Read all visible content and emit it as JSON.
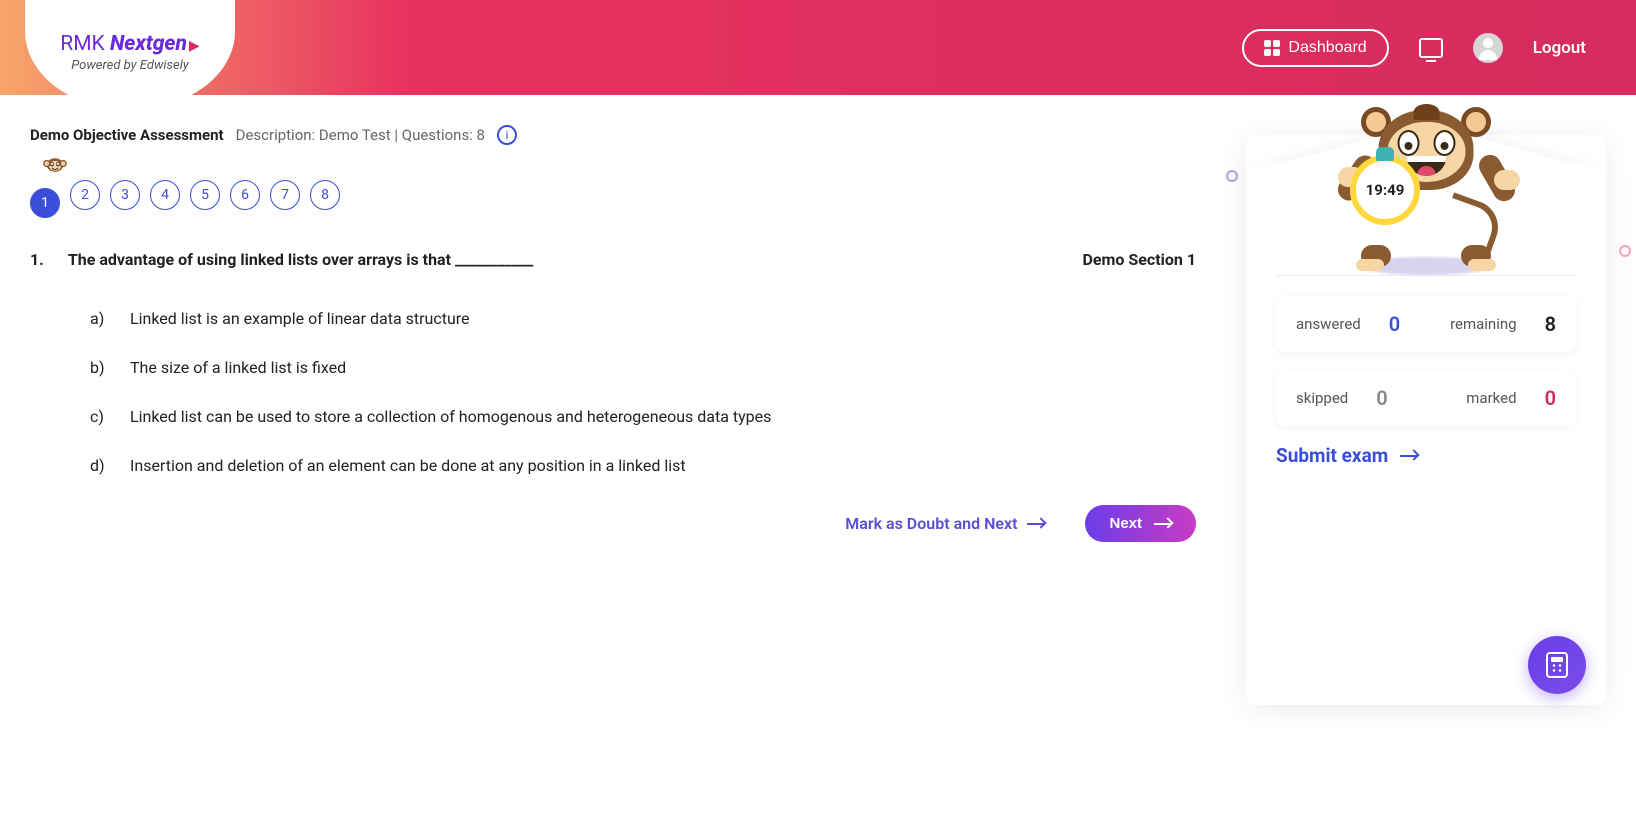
{
  "header": {
    "logo_main_prefix": "RMK ",
    "logo_main_bold": "Nextgen",
    "logo_sub": "Powered by Edwisely",
    "dashboard_label": "Dashboard",
    "logout_label": "Logout"
  },
  "assessment": {
    "title": "Demo Objective Assessment",
    "description_prefix": "Description: ",
    "description": "Demo Test",
    "questions_prefix": " | Questions: ",
    "total_questions": "8"
  },
  "question_nav": [
    "1",
    "2",
    "3",
    "4",
    "5",
    "6",
    "7",
    "8"
  ],
  "current_question_index": 0,
  "question": {
    "number": "1.",
    "text": "The advantage of using linked lists over arrays is that ___________",
    "section": "Demo Section 1",
    "options": [
      {
        "letter": "a)",
        "text": "Linked list is an example of linear data structure"
      },
      {
        "letter": "b)",
        "text": "The size of a linked list is fixed"
      },
      {
        "letter": "c)",
        "text": "Linked list can be used to store a collection of homogenous and heterogeneous data types"
      },
      {
        "letter": "d)",
        "text": "Insertion and deletion of an element can be done at any position in a linked list"
      }
    ]
  },
  "actions": {
    "mark_doubt_label": "Mark as Doubt and Next",
    "next_label": "Next"
  },
  "panel": {
    "timer": "19:49",
    "stats": {
      "answered_label": "answered",
      "answered_value": "0",
      "remaining_label": "remaining",
      "remaining_value": "8",
      "skipped_label": "skipped",
      "skipped_value": "0",
      "marked_label": "marked",
      "marked_value": "0"
    },
    "submit_label": "Submit exam"
  }
}
